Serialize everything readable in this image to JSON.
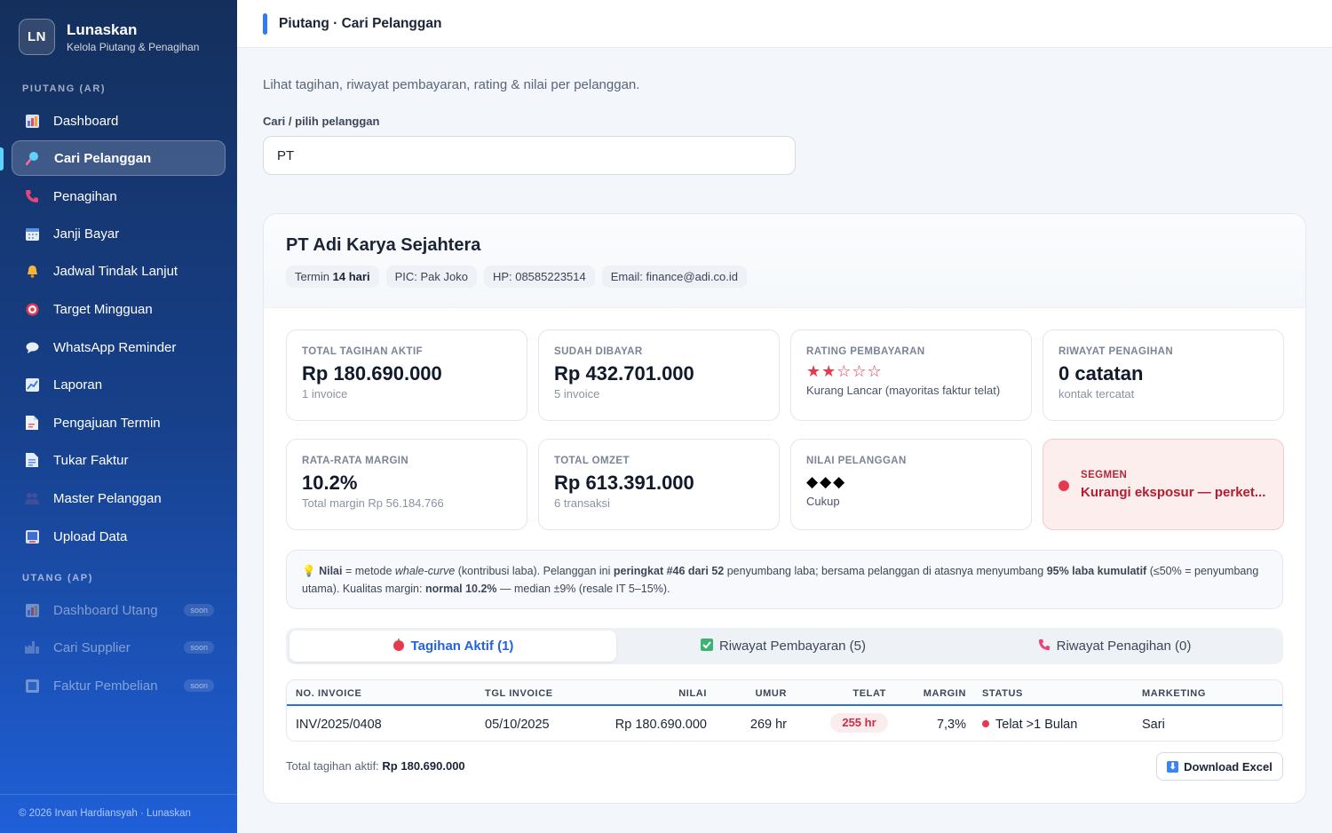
{
  "brand": {
    "logo": "LN",
    "name": "Lunaskan",
    "subtitle": "Kelola Piutang & Penagihan"
  },
  "sidebar": {
    "section_ar": "PIUTANG (AR)",
    "section_ap": "UTANG (AP)",
    "items": [
      {
        "label": "Dashboard",
        "icon": "bar-chart-icon"
      },
      {
        "label": "Cari Pelanggan",
        "icon": "search-icon"
      },
      {
        "label": "Penagihan",
        "icon": "phone-icon"
      },
      {
        "label": "Janji Bayar",
        "icon": "calendar-icon"
      },
      {
        "label": "Jadwal Tindak Lanjut",
        "icon": "bell-icon"
      },
      {
        "label": "Target Mingguan",
        "icon": "target-icon"
      },
      {
        "label": "WhatsApp Reminder",
        "icon": "chat-icon"
      },
      {
        "label": "Laporan",
        "icon": "trend-icon"
      },
      {
        "label": "Pengajuan Termin",
        "icon": "document-icon"
      },
      {
        "label": "Tukar Faktur",
        "icon": "invoice-icon"
      },
      {
        "label": "Master Pelanggan",
        "icon": "users-icon"
      },
      {
        "label": "Upload Data",
        "icon": "upload-icon"
      }
    ],
    "ap_items": [
      {
        "label": "Dashboard Utang",
        "badge": "soon"
      },
      {
        "label": "Cari Supplier",
        "badge": "soon"
      },
      {
        "label": "Faktur Pembelian",
        "badge": "soon"
      }
    ],
    "footer": "© 2026 Irvan Hardiansyah · Lunaskan"
  },
  "header": {
    "title": "Piutang · Cari Pelanggan"
  },
  "page": {
    "description": "Lihat tagihan, riwayat pembayaran, rating & nilai per pelanggan.",
    "search_label": "Cari / pilih pelanggan",
    "search_value": "PT"
  },
  "customer": {
    "name": "PT Adi Karya Sejahtera",
    "termin_prefix": "Termin",
    "termin_value": "14 hari",
    "pic": "PIC: Pak Joko",
    "hp": "HP: 08585223514",
    "email": "Email: finance@adi.co.id"
  },
  "stats": {
    "total_tagihan": {
      "label": "TOTAL TAGIHAN AKTIF",
      "value": "Rp 180.690.000",
      "sub": "1 invoice"
    },
    "sudah_dibayar": {
      "label": "SUDAH DIBAYAR",
      "value": "Rp 432.701.000",
      "sub": "5 invoice"
    },
    "rating": {
      "label": "RATING PEMBAYARAN",
      "stars": "★★☆☆☆",
      "sub": "Kurang Lancar (mayoritas faktur telat)"
    },
    "riwayat": {
      "label": "RIWAYAT PENAGIHAN",
      "value": "0 catatan",
      "sub": "kontak tercatat"
    },
    "margin": {
      "label": "RATA-RATA MARGIN",
      "value": "10.2%",
      "sub": "Total margin Rp 56.184.766"
    },
    "omzet": {
      "label": "TOTAL OMZET",
      "value": "Rp 613.391.000",
      "sub": "6 transaksi"
    },
    "nilai": {
      "label": "NILAI PELANGGAN",
      "diamonds": "◆◆◆",
      "sub": "Cukup"
    },
    "segmen": {
      "label": "SEGMEN",
      "value": "Kurangi eksposur — perket..."
    }
  },
  "note": {
    "icon": "lightbulb-icon",
    "t1": "Nilai",
    "t2": " = metode ",
    "t3": "whale-curve",
    "t4": " (kontribusi laba). Pelanggan ini ",
    "t5": "peringkat #46 dari 52",
    "t6": " penyumbang laba; bersama pelanggan di atasnya menyumbang ",
    "t7": "95% laba kumulatif",
    "t8": " (≤50% = penyumbang utama). Kualitas margin: ",
    "t9": "normal 10.2%",
    "t10": " — median ±9% (resale IT 5–15%)."
  },
  "tabs": [
    {
      "label": "Tagihan Aktif (1)"
    },
    {
      "label": "Riwayat Pembayaran (5)"
    },
    {
      "label": "Riwayat Penagihan (0)"
    }
  ],
  "table": {
    "headers": [
      "NO. INVOICE",
      "TGL INVOICE",
      "NILAI",
      "UMUR",
      "TELAT",
      "MARGIN",
      "STATUS",
      "MARKETING"
    ],
    "rows": [
      {
        "invoice": "INV/2025/0408",
        "date": "05/10/2025",
        "nilai": "Rp 180.690.000",
        "umur": "269 hr",
        "telat": "255 hr",
        "margin": "7,3%",
        "status": "Telat >1 Bulan",
        "marketing": "Sari"
      }
    ]
  },
  "summary": {
    "label": "Total tagihan aktif:",
    "value": "Rp 180.690.000"
  },
  "download_button": "Download Excel",
  "colors": {
    "accent": "#2f7bf5",
    "danger": "#e8384f",
    "sidebar_top": "#142f5c",
    "sidebar_bottom": "#1f5fd8"
  }
}
